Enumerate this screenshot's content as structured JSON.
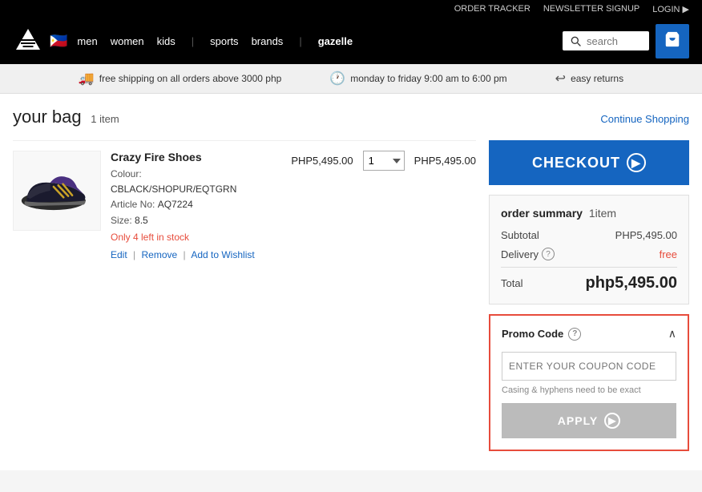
{
  "topLinks": {
    "orderTracker": "ORDER TRACKER",
    "newsletterSignup": "NEWSLETTER SIGNUP",
    "login": "LOGIN"
  },
  "nav": {
    "logoAlt": "adidas",
    "flag": "🇵🇭",
    "links": [
      "men",
      "women",
      "kids",
      "sports",
      "brands",
      "gazelle"
    ],
    "searchPlaceholder": "search",
    "cartIcon": "🛒"
  },
  "utilityBar": {
    "shipping": "free shipping on all orders above 3000 php",
    "hours": "monday to friday 9:00 am to 6:00 pm",
    "returns": "easy returns"
  },
  "bag": {
    "title": "your bag",
    "itemCount": "1 item",
    "continueShopping": "Continue Shopping"
  },
  "product": {
    "name": "Crazy Fire Shoes",
    "colourLabel": "Colour:",
    "colourValue": "CBLACK/SHOPUR/EQTGRN",
    "articleLabel": "Article No:",
    "articleValue": "AQ7224",
    "sizeLabel": "Size:",
    "sizeValue": "8.5",
    "stockWarning": "Only 4 left in stock",
    "unitPrice": "PHP5,495.00",
    "qty": "1",
    "totalPrice": "PHP5,495.00",
    "editLink": "Edit",
    "removeLink": "Remove",
    "wishlistLink": "Add to Wishlist"
  },
  "orderSummary": {
    "title": "order summary",
    "itemCount": "1item",
    "subtotalLabel": "Subtotal",
    "subtotalValue": "PHP5,495.00",
    "deliveryLabel": "Delivery",
    "deliveryValue": "free",
    "totalLabel": "Total",
    "totalValue": "php5,495.00"
  },
  "checkout": {
    "buttonLabel": "CHECKOUT"
  },
  "promo": {
    "title": "Promo Code",
    "inputPlaceholder": "ENTER YOUR COUPON CODE",
    "hint": "Casing & hyphens need to be exact",
    "applyLabel": "APPLY"
  }
}
